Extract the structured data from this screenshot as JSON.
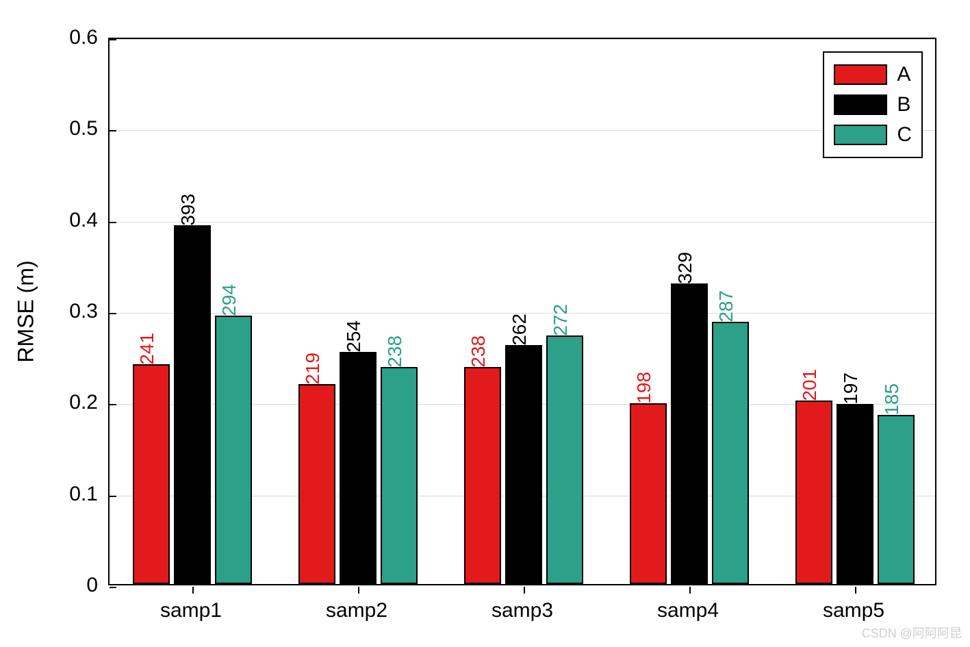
{
  "chart_data": {
    "type": "bar",
    "categories": [
      "samp1",
      "samp2",
      "samp3",
      "samp4",
      "samp5"
    ],
    "series": [
      {
        "name": "A",
        "color": "#e31a1c",
        "values": [
          0.241,
          0.219,
          0.238,
          0.198,
          0.201
        ]
      },
      {
        "name": "B",
        "color": "#000000",
        "values": [
          0.393,
          0.254,
          0.262,
          0.329,
          0.197
        ]
      },
      {
        "name": "C",
        "color": "#2ca089",
        "values": [
          0.294,
          0.238,
          0.272,
          0.287,
          0.185
        ]
      }
    ],
    "ylabel": "RMSE (m)",
    "xlabel": "",
    "ylim": [
      0,
      0.6
    ],
    "yticks": [
      0,
      0.1,
      0.2,
      0.3,
      0.4,
      0.5,
      0.6
    ],
    "ytick_labels": [
      "0",
      "0.1",
      "0.2",
      "0.3",
      "0.4",
      "0.5",
      "0.6"
    ],
    "grid": true,
    "legend_position": "top-right"
  },
  "watermark": "CSDN @阿阿阿昆"
}
